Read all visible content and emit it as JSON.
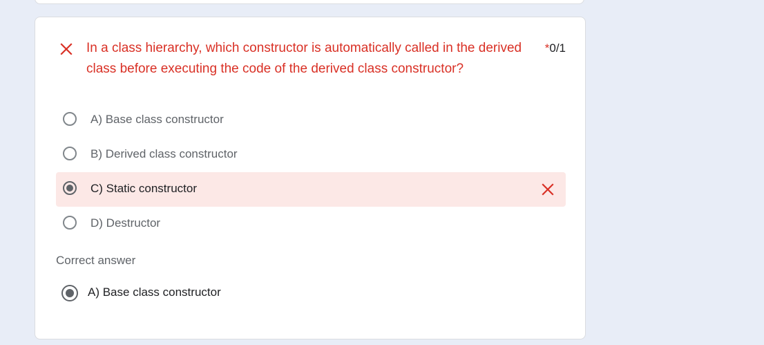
{
  "question": {
    "text": "In a class hierarchy, which constructor is automatically called in the derived class before executing the code of the derived class constructor?",
    "required_marker": "*",
    "score": "0/1",
    "status_icon": "close-icon"
  },
  "options": [
    {
      "label": "A) Base class constructor",
      "selected": false
    },
    {
      "label": "B) Derived class constructor",
      "selected": false
    },
    {
      "label": "C) Static constructor",
      "selected": true,
      "incorrect": true
    },
    {
      "label": "D) Destructor",
      "selected": false
    }
  ],
  "correct_answer": {
    "title": "Correct answer",
    "label": "A) Base class constructor"
  },
  "colors": {
    "error": "#d93025",
    "wrong_bg": "#fce8e6",
    "page_bg": "#e8edf7"
  }
}
